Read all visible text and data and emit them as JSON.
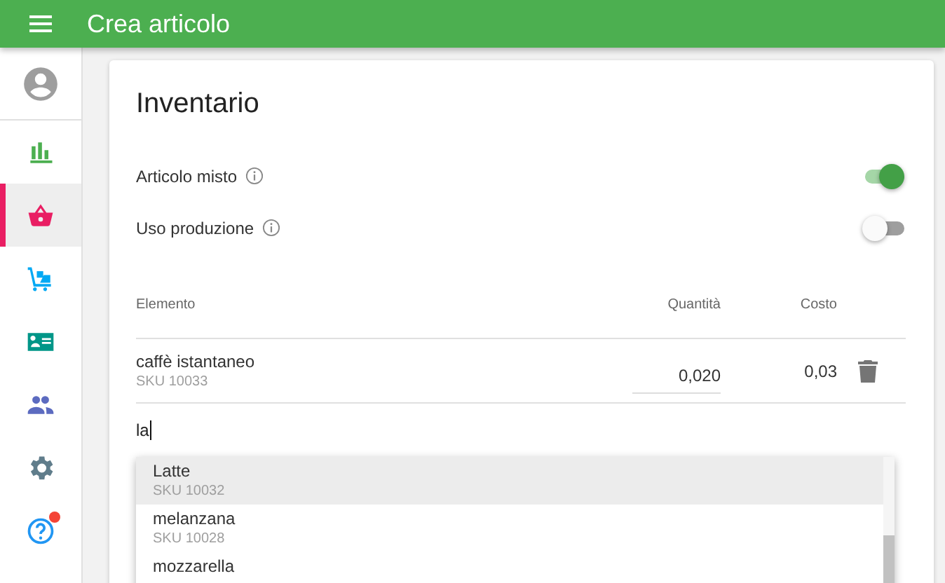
{
  "app_bar": {
    "title": "Crea articolo"
  },
  "sidebar": {
    "items": [
      {
        "kind": "chart",
        "selected": false
      },
      {
        "kind": "basket",
        "selected": true
      },
      {
        "kind": "cart",
        "selected": false
      },
      {
        "kind": "card",
        "selected": false
      },
      {
        "kind": "people",
        "selected": false
      },
      {
        "kind": "gear",
        "selected": false
      },
      {
        "kind": "help",
        "selected": false,
        "notification": true
      }
    ]
  },
  "card": {
    "title": "Inventario",
    "toggles": [
      {
        "label": "Articolo misto",
        "on": true
      },
      {
        "label": "Uso produzione",
        "on": false
      }
    ],
    "table": {
      "columns": [
        "Elemento",
        "Quantità",
        "Costo"
      ],
      "rows": [
        {
          "name": "caffè istantaneo",
          "sku": "SKU 10033",
          "quantity": "0,020",
          "cost": "0,03"
        }
      ]
    },
    "search": {
      "value": "la"
    },
    "suggestions": [
      {
        "name": "Latte",
        "sku": "SKU 10032",
        "selected": true
      },
      {
        "name": "melanzana",
        "sku": "SKU 10028",
        "selected": false
      },
      {
        "name": "mozzarella",
        "selected": false
      }
    ]
  }
}
